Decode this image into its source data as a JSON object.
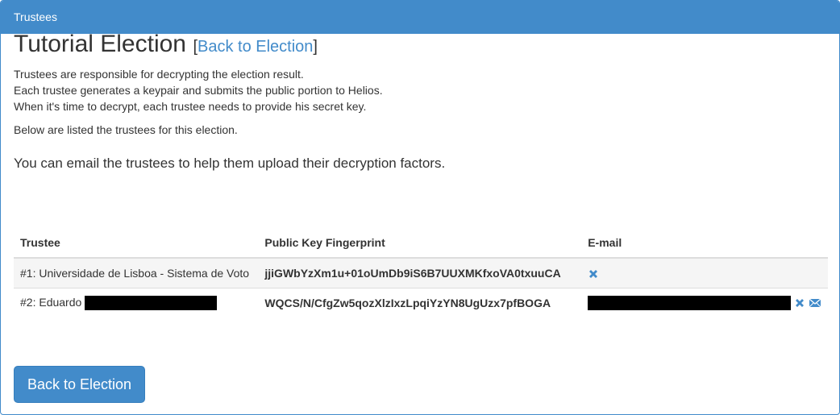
{
  "panel": {
    "heading": "Trustees"
  },
  "election": {
    "title": "Tutorial Election",
    "bracket_open": "[",
    "back_link": "Back to Election",
    "bracket_close": "]"
  },
  "description": [
    "Trustees are responsible for decrypting the election result.",
    "Each trustee generates a keypair and submits the public portion to Helios.",
    "When it's time to decrypt, each trustee needs to provide his secret key."
  ],
  "listed_text": "Below are listed the trustees for this election.",
  "email_note": "You can email the trustees to help them upload their decryption factors.",
  "table": {
    "headers": [
      "Trustee",
      "Public Key Fingerprint",
      "E-mail"
    ],
    "rows": [
      {
        "trustee": "#1: Universidade de Lisboa - Sistema de Voto",
        "fingerprint": "jjiGWbYzXm1u+01oUmDb9iS6B7UUXMKfxoVA0txuuCA",
        "has_email": false
      },
      {
        "trustee": "#2: Eduardo",
        "fingerprint": "WQCS/N/CfgZw5qozXlzIxzLpqiYzYN8UgUzx7pfBOGA",
        "has_email": true
      }
    ]
  },
  "icons": {
    "delete": "close-icon",
    "email": "envelope-icon"
  },
  "colors": {
    "primary": "#428bca",
    "redaction": "#000000"
  },
  "footer": {
    "back_button": "Back to Election"
  }
}
